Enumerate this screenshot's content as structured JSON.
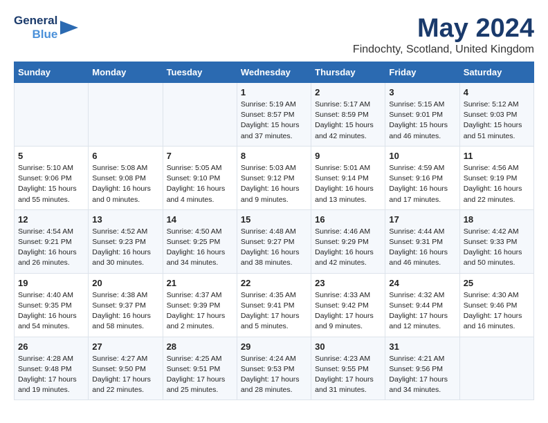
{
  "logo": {
    "line1": "General",
    "line2": "Blue"
  },
  "title": "May 2024",
  "subtitle": "Findochty, Scotland, United Kingdom",
  "days_header": [
    "Sunday",
    "Monday",
    "Tuesday",
    "Wednesday",
    "Thursday",
    "Friday",
    "Saturday"
  ],
  "weeks": [
    [
      {
        "day": "",
        "content": ""
      },
      {
        "day": "",
        "content": ""
      },
      {
        "day": "",
        "content": ""
      },
      {
        "day": "1",
        "content": "Sunrise: 5:19 AM\nSunset: 8:57 PM\nDaylight: 15 hours and 37 minutes."
      },
      {
        "day": "2",
        "content": "Sunrise: 5:17 AM\nSunset: 8:59 PM\nDaylight: 15 hours and 42 minutes."
      },
      {
        "day": "3",
        "content": "Sunrise: 5:15 AM\nSunset: 9:01 PM\nDaylight: 15 hours and 46 minutes."
      },
      {
        "day": "4",
        "content": "Sunrise: 5:12 AM\nSunset: 9:03 PM\nDaylight: 15 hours and 51 minutes."
      }
    ],
    [
      {
        "day": "5",
        "content": "Sunrise: 5:10 AM\nSunset: 9:06 PM\nDaylight: 15 hours and 55 minutes."
      },
      {
        "day": "6",
        "content": "Sunrise: 5:08 AM\nSunset: 9:08 PM\nDaylight: 16 hours and 0 minutes."
      },
      {
        "day": "7",
        "content": "Sunrise: 5:05 AM\nSunset: 9:10 PM\nDaylight: 16 hours and 4 minutes."
      },
      {
        "day": "8",
        "content": "Sunrise: 5:03 AM\nSunset: 9:12 PM\nDaylight: 16 hours and 9 minutes."
      },
      {
        "day": "9",
        "content": "Sunrise: 5:01 AM\nSunset: 9:14 PM\nDaylight: 16 hours and 13 minutes."
      },
      {
        "day": "10",
        "content": "Sunrise: 4:59 AM\nSunset: 9:16 PM\nDaylight: 16 hours and 17 minutes."
      },
      {
        "day": "11",
        "content": "Sunrise: 4:56 AM\nSunset: 9:19 PM\nDaylight: 16 hours and 22 minutes."
      }
    ],
    [
      {
        "day": "12",
        "content": "Sunrise: 4:54 AM\nSunset: 9:21 PM\nDaylight: 16 hours and 26 minutes."
      },
      {
        "day": "13",
        "content": "Sunrise: 4:52 AM\nSunset: 9:23 PM\nDaylight: 16 hours and 30 minutes."
      },
      {
        "day": "14",
        "content": "Sunrise: 4:50 AM\nSunset: 9:25 PM\nDaylight: 16 hours and 34 minutes."
      },
      {
        "day": "15",
        "content": "Sunrise: 4:48 AM\nSunset: 9:27 PM\nDaylight: 16 hours and 38 minutes."
      },
      {
        "day": "16",
        "content": "Sunrise: 4:46 AM\nSunset: 9:29 PM\nDaylight: 16 hours and 42 minutes."
      },
      {
        "day": "17",
        "content": "Sunrise: 4:44 AM\nSunset: 9:31 PM\nDaylight: 16 hours and 46 minutes."
      },
      {
        "day": "18",
        "content": "Sunrise: 4:42 AM\nSunset: 9:33 PM\nDaylight: 16 hours and 50 minutes."
      }
    ],
    [
      {
        "day": "19",
        "content": "Sunrise: 4:40 AM\nSunset: 9:35 PM\nDaylight: 16 hours and 54 minutes."
      },
      {
        "day": "20",
        "content": "Sunrise: 4:38 AM\nSunset: 9:37 PM\nDaylight: 16 hours and 58 minutes."
      },
      {
        "day": "21",
        "content": "Sunrise: 4:37 AM\nSunset: 9:39 PM\nDaylight: 17 hours and 2 minutes."
      },
      {
        "day": "22",
        "content": "Sunrise: 4:35 AM\nSunset: 9:41 PM\nDaylight: 17 hours and 5 minutes."
      },
      {
        "day": "23",
        "content": "Sunrise: 4:33 AM\nSunset: 9:42 PM\nDaylight: 17 hours and 9 minutes."
      },
      {
        "day": "24",
        "content": "Sunrise: 4:32 AM\nSunset: 9:44 PM\nDaylight: 17 hours and 12 minutes."
      },
      {
        "day": "25",
        "content": "Sunrise: 4:30 AM\nSunset: 9:46 PM\nDaylight: 17 hours and 16 minutes."
      }
    ],
    [
      {
        "day": "26",
        "content": "Sunrise: 4:28 AM\nSunset: 9:48 PM\nDaylight: 17 hours and 19 minutes."
      },
      {
        "day": "27",
        "content": "Sunrise: 4:27 AM\nSunset: 9:50 PM\nDaylight: 17 hours and 22 minutes."
      },
      {
        "day": "28",
        "content": "Sunrise: 4:25 AM\nSunset: 9:51 PM\nDaylight: 17 hours and 25 minutes."
      },
      {
        "day": "29",
        "content": "Sunrise: 4:24 AM\nSunset: 9:53 PM\nDaylight: 17 hours and 28 minutes."
      },
      {
        "day": "30",
        "content": "Sunrise: 4:23 AM\nSunset: 9:55 PM\nDaylight: 17 hours and 31 minutes."
      },
      {
        "day": "31",
        "content": "Sunrise: 4:21 AM\nSunset: 9:56 PM\nDaylight: 17 hours and 34 minutes."
      },
      {
        "day": "",
        "content": ""
      }
    ]
  ]
}
